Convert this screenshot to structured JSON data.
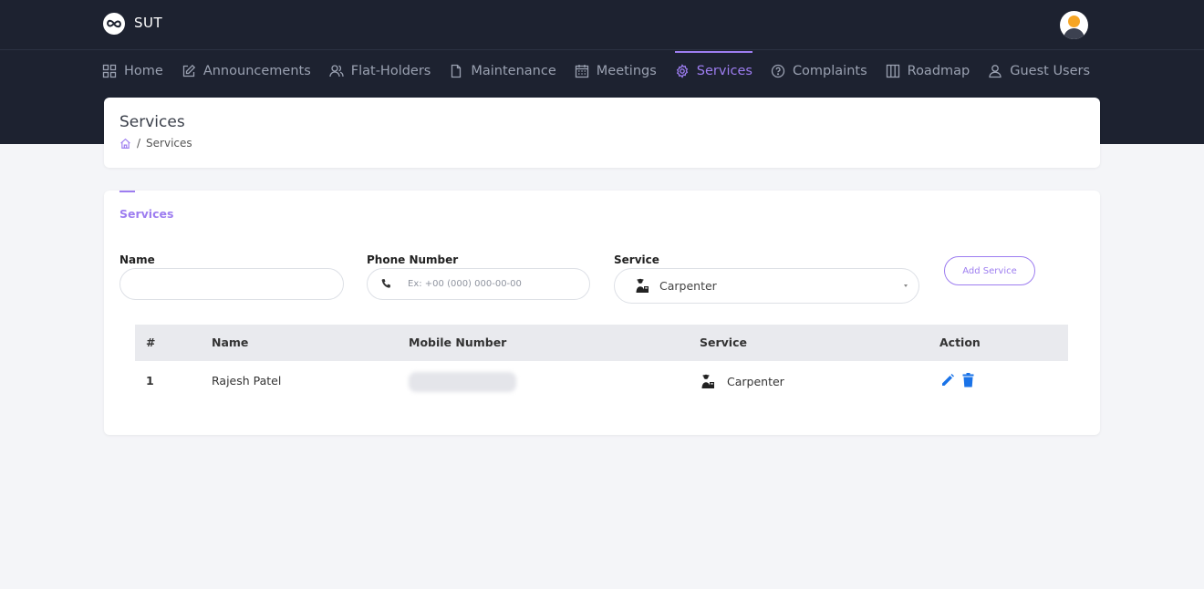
{
  "app": {
    "name": "SUT"
  },
  "nav": {
    "items": [
      {
        "label": "Home",
        "icon": "grid-icon"
      },
      {
        "label": "Announcements",
        "icon": "edit-icon"
      },
      {
        "label": "Flat-Holders",
        "icon": "users-icon"
      },
      {
        "label": "Maintenance",
        "icon": "file-icon"
      },
      {
        "label": "Meetings",
        "icon": "calendar-icon"
      },
      {
        "label": "Services",
        "icon": "gear-icon",
        "active": true
      },
      {
        "label": "Complaints",
        "icon": "help-circle-icon"
      },
      {
        "label": "Roadmap",
        "icon": "columns-icon"
      },
      {
        "label": "Guest Users",
        "icon": "user-icon"
      }
    ]
  },
  "page": {
    "title": "Services",
    "breadcrumb": {
      "separator": "/",
      "current": "Services"
    }
  },
  "form": {
    "section_title": "Services",
    "name_label": "Name",
    "name_value": "",
    "phone_label": "Phone Number",
    "phone_placeholder": "Ex: +00 (000) 000-00-00",
    "service_label": "Service",
    "service_value": "Carpenter",
    "add_button": "Add Service"
  },
  "table": {
    "headers": [
      "#",
      "Name",
      "Mobile Number",
      "Service",
      "Action"
    ],
    "rows": [
      {
        "index": "1",
        "name": "Rajesh Patel",
        "service": "Carpenter"
      }
    ]
  },
  "colors": {
    "accent": "#9d7df0",
    "topbar": "#1d2230",
    "action_blue": "#1a73e8"
  }
}
